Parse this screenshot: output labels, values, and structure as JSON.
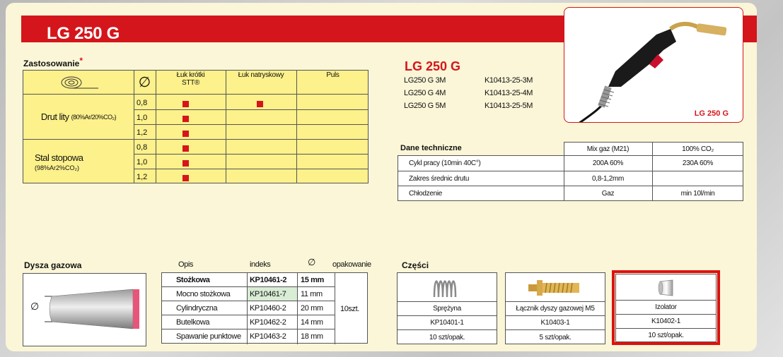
{
  "header": {
    "title": "LG 250 G"
  },
  "application": {
    "label": "Zastosowanie",
    "star": "*",
    "columns": [
      "Łuk krótki STT®",
      "Łuk natryskowy",
      "Puls"
    ],
    "diameter_symbol": "∅",
    "groups": [
      {
        "name": "Drut lity",
        "note": "(80%Ar/20%CO₂)",
        "rows": [
          {
            "d": "0,8",
            "short": true,
            "spray": true,
            "pulse": false
          },
          {
            "d": "1,0",
            "short": true,
            "spray": false,
            "pulse": false
          },
          {
            "d": "1,2",
            "short": true,
            "spray": false,
            "pulse": false
          }
        ]
      },
      {
        "name": "Stal stopowa",
        "note": "(98%Ar2%CO₂)",
        "rows": [
          {
            "d": "0,8",
            "short": true,
            "spray": false,
            "pulse": false
          },
          {
            "d": "1,0",
            "short": true,
            "spray": false,
            "pulse": false
          },
          {
            "d": "1,2",
            "short": true,
            "spray": false,
            "pulse": false
          }
        ]
      }
    ]
  },
  "product": {
    "name": "LG 250 G",
    "variants": [
      {
        "name": "LG250 G 3M",
        "code": "K10413-25-3M"
      },
      {
        "name": "LG250 G 4M",
        "code": "K10413-25-4M"
      },
      {
        "name": "LG250 G 5M",
        "code": "K10413-25-5M"
      }
    ],
    "image_label": "LG 250 G"
  },
  "technical": {
    "label": "Dane techniczne",
    "headers": [
      "Mix gaz (M21)",
      "100% CO₂"
    ],
    "rows": [
      {
        "name": "Cykl pracy (10min 40C°)",
        "mix": "200A 60%",
        "co2": "230A 60%"
      },
      {
        "name": "Zakres średnic drutu",
        "mix": "0,8-1,2mm",
        "co2": ""
      },
      {
        "name": "Chłodzenie",
        "mix": "Gaz",
        "co2": "min 10l/min"
      }
    ]
  },
  "nozzle": {
    "label": "Dysza gazowa",
    "diameter_symbol": "∅",
    "headers": {
      "opis": "Opis",
      "indeks": "indeks",
      "diameter": "∅",
      "packaging": "opakowanie"
    },
    "rows": [
      {
        "opis": "Stożkowa",
        "indeks": "KP10461-2",
        "size": "15 mm",
        "bold": true
      },
      {
        "opis": "Mocno stożkowa",
        "indeks": "KP10461-7",
        "size": "11 mm"
      },
      {
        "opis": "Cylindryczna",
        "indeks": "KP10460-2",
        "size": "20 mm"
      },
      {
        "opis": "Butelkowa",
        "indeks": "KP10462-2",
        "size": "14 mm"
      },
      {
        "opis": "Spawanie punktowe",
        "indeks": "KP10463-2",
        "size": "18 mm"
      }
    ],
    "packaging": "10szt."
  },
  "parts": {
    "label": "Części",
    "items": [
      {
        "name": "Sprężyna",
        "code": "KP10401-1",
        "pack": "10 szt/opak."
      },
      {
        "name": "Łącznik dyszy gazowej M5",
        "code": "K10403-1",
        "pack": "5 szt/opak."
      },
      {
        "name": "Izolator",
        "code": "K10402-1",
        "pack": "10 szt/opak."
      }
    ]
  },
  "colors": {
    "brand_red": "#d4161c",
    "table_yellow": "#fdf18b",
    "panel": "#fbf6d7",
    "highlight": "#e0100f"
  }
}
